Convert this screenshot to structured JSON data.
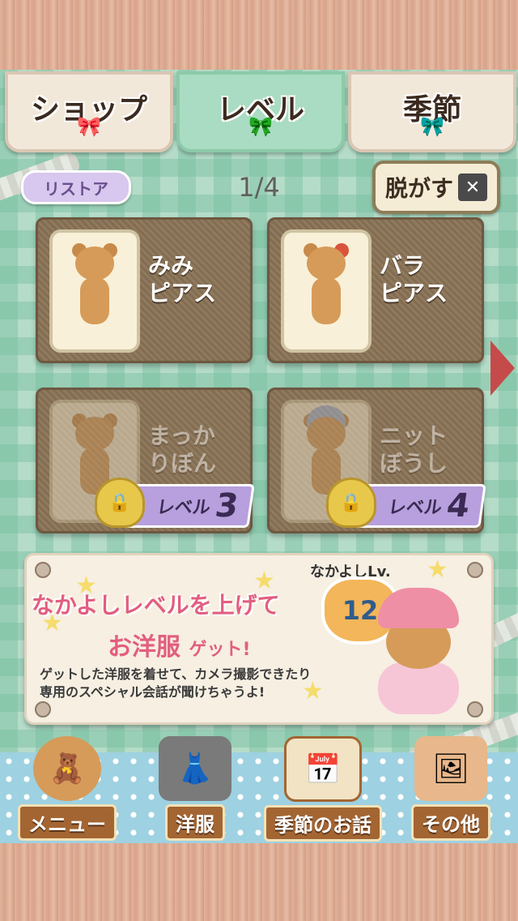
{
  "tabs": [
    {
      "label": "ショップ",
      "bow": "🎀",
      "state": "inactive"
    },
    {
      "label": "レベル",
      "bow": "🎀",
      "state": "active"
    },
    {
      "label": "季節",
      "bow": "🎀",
      "state": "inactive"
    }
  ],
  "toolbar": {
    "restore_label": "リストア",
    "page_indicator": "1/4",
    "undress_label": "脱がす"
  },
  "items": [
    {
      "name": "みみ\nピアス",
      "locked": false
    },
    {
      "name": "バラ\nピアス",
      "locked": false
    },
    {
      "name": "まっか\nりぼん",
      "locked": true,
      "level_label": "レベル",
      "level": "3"
    },
    {
      "name": "ニット\nぼうし",
      "locked": true,
      "level_label": "レベル",
      "level": "4"
    }
  ],
  "banner": {
    "level_label": "なかよしLv.",
    "level_value": "12",
    "headline": "なかよしレベルを上げて",
    "subline_main": "お洋服",
    "subline_suffix": "ゲット!",
    "description": "ゲットした洋服を着せて、カメラ撮影できたり\n専用のスペシャル会話が聞けちゃうよ!"
  },
  "nav": [
    {
      "label": "メニュー",
      "icon": "bear-icon"
    },
    {
      "label": "洋服",
      "icon": "clothes-icon"
    },
    {
      "label": "季節のお話",
      "icon": "calendar-icon"
    },
    {
      "label": "その他",
      "icon": "photos-icon"
    }
  ],
  "colors": {
    "accent_pink": "#e25e7f",
    "active_tab": "#a9dcc2",
    "lock_ribbon": "#b7a0dd",
    "next_arrow": "#c54b4b"
  }
}
